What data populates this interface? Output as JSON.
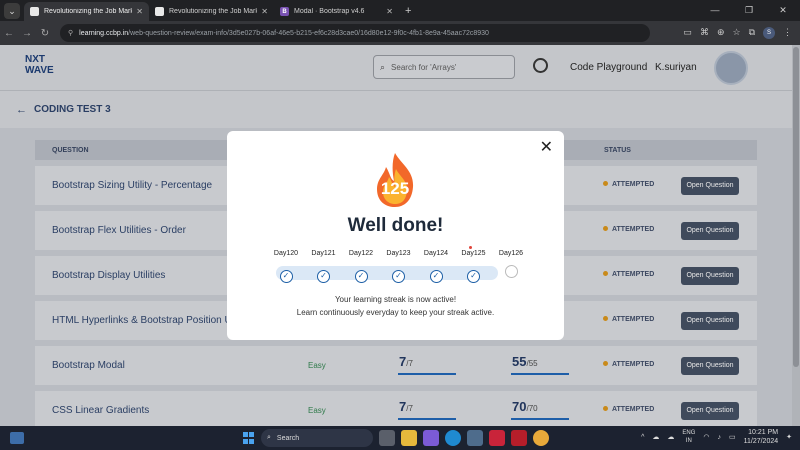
{
  "browser": {
    "tabs": [
      {
        "label": "Revolutionizing the Job Market",
        "fav": "cc",
        "active": true
      },
      {
        "label": "Revolutionizing the Job Market",
        "fav": "cc",
        "active": false
      },
      {
        "label": "Modal · Bootstrap v4.6",
        "fav": "bs",
        "active": false
      }
    ],
    "url_host": "learning.ccbp.in",
    "url_path": "/web-question-review/exam-info/3d5e027b-06af-46e5-b215-ef6c28d3cae0/16d80e12-9f0c-4fb1-8e9a-45aac72c8930",
    "profile_initial": "S"
  },
  "header": {
    "logo_line1": "NXT",
    "logo_line2": "WAVE",
    "search_placeholder": "Search for 'Arrays'",
    "code_playground": "Code Playground",
    "username": "K.suriyan"
  },
  "subbar": {
    "title": "CODING TEST 3"
  },
  "table": {
    "col_question": "QUESTION",
    "col_status": "STATUS",
    "rows": [
      {
        "question": "Bootstrap Sizing Utility - Percentage",
        "difficulty": "",
        "score": "",
        "score_total": "",
        "points": "",
        "points_total": "",
        "status": "ATTEMPTED",
        "action": "Open Question"
      },
      {
        "question": "Bootstrap Flex Utilities - Order",
        "difficulty": "",
        "score": "",
        "score_total": "",
        "points": "",
        "points_total": "",
        "status": "ATTEMPTED",
        "action": "Open Question"
      },
      {
        "question": "Bootstrap Display Utilities",
        "difficulty": "",
        "score": "",
        "score_total": "",
        "points": "",
        "points_total": "",
        "status": "ATTEMPTED",
        "action": "Open Question"
      },
      {
        "question": "HTML Hyperlinks & Bootstrap Position U",
        "difficulty": "",
        "score": "",
        "score_total": "",
        "points": "",
        "points_total": "",
        "status": "ATTEMPTED",
        "action": "Open Question"
      },
      {
        "question": "Bootstrap Modal",
        "difficulty": "Easy",
        "score": "7",
        "score_total": "/7",
        "points": "55",
        "points_total": "/55",
        "status": "ATTEMPTED",
        "action": "Open Question"
      },
      {
        "question": "CSS Linear Gradients",
        "difficulty": "Easy",
        "score": "7",
        "score_total": "/7",
        "points": "70",
        "points_total": "/70",
        "status": "ATTEMPTED",
        "action": "Open Question"
      }
    ]
  },
  "modal": {
    "streak_count": "125",
    "title": "Well done!",
    "days": [
      {
        "label": "Day120",
        "done": true
      },
      {
        "label": "Day121",
        "done": true
      },
      {
        "label": "Day122",
        "done": true
      },
      {
        "label": "Day123",
        "done": true
      },
      {
        "label": "Day124",
        "done": true
      },
      {
        "label": "Day125",
        "done": true
      },
      {
        "label": "Day126",
        "done": false
      }
    ],
    "message_line1": "Your learning streak is now active!",
    "message_line2": "Learn continuously everyday to keep your streak active."
  },
  "taskbar": {
    "search_label": "Search",
    "lang_line1": "ENG",
    "lang_line2": "IN",
    "time": "10:21 PM",
    "date": "11/27/2024"
  },
  "icons": {
    "check": "✓",
    "close": "✕",
    "back": "←"
  }
}
